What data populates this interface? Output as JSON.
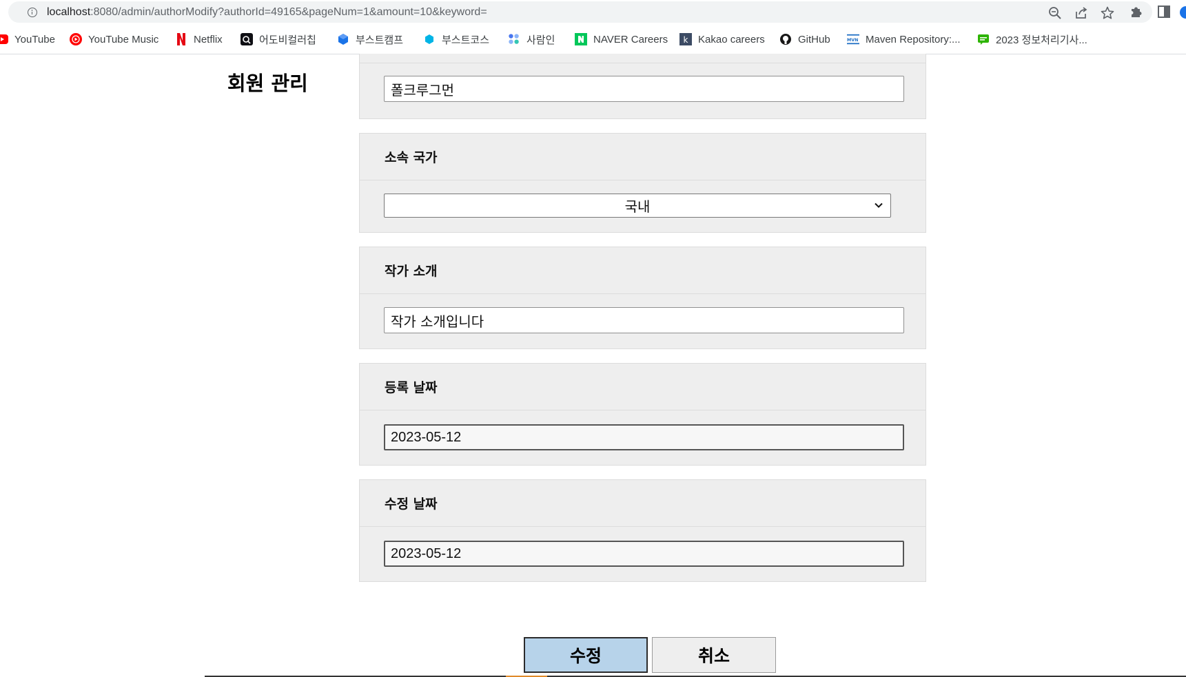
{
  "browser": {
    "url_host": "localhost",
    "url_rest": ":8080/admin/authorModify?authorId=49165&pageNum=1&amount=10&keyword=",
    "toolbar_icons": [
      "zoom-icon",
      "share-icon",
      "star-icon",
      "extensions-icon",
      "side-panel-icon"
    ],
    "bookmarks": [
      {
        "label": "YouTube",
        "icon": "youtube-icon",
        "color": "#ff0000"
      },
      {
        "label": "YouTube Music",
        "icon": "youtube-music-icon",
        "color": "#ff0000"
      },
      {
        "label": "Netflix",
        "icon": "netflix-icon",
        "color": "#e50914"
      },
      {
        "label": "어도비컬러칩",
        "icon": "adobe-color-icon",
        "color": "#0f0f14"
      },
      {
        "label": "부스트캠프",
        "icon": "boostcamp-icon",
        "color": "#1a73e8"
      },
      {
        "label": "부스트코스",
        "icon": "boostcourse-icon",
        "color": "#00b4e6"
      },
      {
        "label": "사람인",
        "icon": "saramin-icon",
        "color": "#4876ef"
      },
      {
        "label": "NAVER Careers",
        "icon": "naver-icon",
        "color": "#03c75a"
      },
      {
        "label": "Kakao careers",
        "icon": "kakao-icon",
        "color": "#3c4b64"
      },
      {
        "label": "GitHub",
        "icon": "github-icon",
        "color": "#181717"
      },
      {
        "label": "Maven Repository:...",
        "icon": "maven-icon",
        "color": "#1f6fc5"
      },
      {
        "label": "2023 정보처리기사...",
        "icon": "chat-icon",
        "color": "#2db400"
      }
    ]
  },
  "page": {
    "heading": "회원 관리",
    "name_field": {
      "value": "폴크루그먼"
    },
    "nation": {
      "label": "소속 국가",
      "selected": "국내"
    },
    "intro": {
      "label": "작가 소개",
      "value": "작가 소개입니다"
    },
    "reg_date": {
      "label": "등록 날짜",
      "value": "2023-05-12"
    },
    "update_date": {
      "label": "수정 날짜",
      "value": "2023-05-12"
    },
    "buttons": {
      "modify": "수정",
      "cancel": "취소"
    }
  }
}
